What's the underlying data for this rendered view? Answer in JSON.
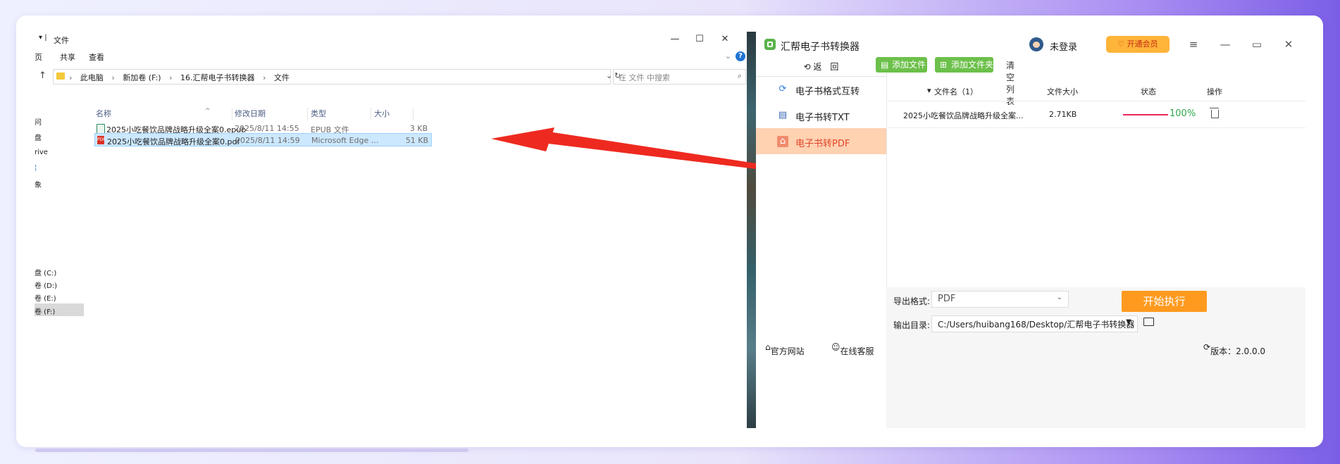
{
  "explorer": {
    "title": "文件",
    "ribbon": [
      "页",
      "共享",
      "查看"
    ],
    "breadcrumb": [
      "此电脑",
      "新加卷 (F:)",
      "16.汇帮电子书转换器",
      "文件"
    ],
    "search_placeholder": "在 文件 中搜索",
    "nav": [
      "问",
      "盘",
      "rive",
      "",
      "象",
      "盘 (C:)",
      "卷 (D:)",
      "卷 (E:)",
      "卷 (F:)"
    ],
    "columns": {
      "name": "名称",
      "date": "修改日期",
      "type": "类型",
      "size": "大小"
    },
    "files": [
      {
        "name": "2025小吃餐饮品牌战略升级全案0.epub",
        "date": "2025/8/11 14:55",
        "type": "EPUB 文件",
        "size": "3 KB",
        "icon": "epub-icon"
      },
      {
        "name": "2025小吃餐饮品牌战略升级全案0.pdf",
        "date": "2025/8/11 14:59",
        "type": "Microsoft Edge ...",
        "size": "51 KB",
        "icon": "pdf-icon"
      }
    ]
  },
  "app": {
    "title": "汇帮电子书转换器",
    "login": "未登录",
    "vip": "开通会员",
    "back": "返　回",
    "menu": [
      "电子书格式互转",
      "电子书转TXT",
      "电子书转PDF"
    ],
    "toolbar": {
      "add_file": "添加文件",
      "add_folder": "添加文件夹",
      "clear": "清空列表"
    },
    "table": {
      "col_name": "文件名（1）",
      "col_size": "文件大小",
      "col_status": "状态",
      "col_action": "操作",
      "rows": [
        {
          "name": "2025小吃餐饮品牌战略升级全案...",
          "size": "2.71KB",
          "progress": "100%"
        }
      ]
    },
    "export_format_label": "导出格式:",
    "export_format": "PDF",
    "output_dir_label": "输出目录:",
    "output_dir": "C:/Users/huibang168/Desktop/汇帮电子书转换器",
    "start": "开始执行",
    "footer": {
      "site": "官方网站",
      "service": "在线客服",
      "version": "版本：2.0.0.0"
    }
  },
  "colors": {
    "accent_green": "#6cc04a",
    "active_menu": "#ffd2b2",
    "start_button": "#ff9a1f",
    "arrow": "#ee2a20"
  }
}
